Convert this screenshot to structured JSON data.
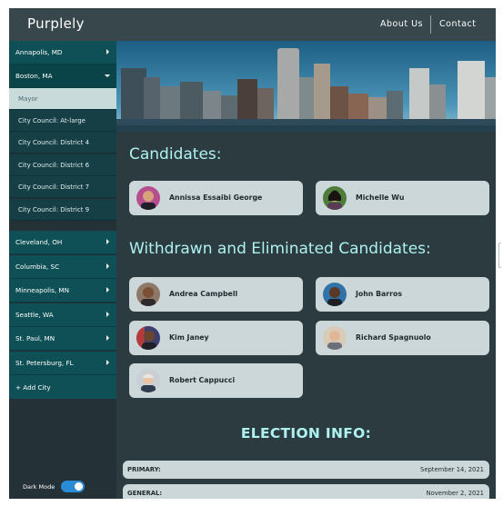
{
  "app": {
    "brand": "Purplely"
  },
  "nav": {
    "links": [
      "About Us",
      "Contact"
    ]
  },
  "sidebar": {
    "cities": [
      "Annapolis, MD",
      "Boston, MA",
      "Cleveland, OH",
      "Columbia, SC",
      "Minneapolis, MN",
      "Seattle, WA",
      "St. Paul, MN",
      "St. Petersburg, FL"
    ],
    "open_city": "Boston, MA",
    "races": [
      "Mayor",
      "City Council: At-large",
      "City Council: District 4",
      "City Council: District 6",
      "City Council: District 7",
      "City Council: District 9"
    ],
    "active_race": "Mayor",
    "add_city": "+ Add City",
    "dark_mode_label": "Dark Mode",
    "dark_mode_on": true
  },
  "main": {
    "candidates_title": "Candidates:",
    "candidates": [
      {
        "name": "Annissa Essaibi George"
      },
      {
        "name": "Michelle Wu"
      }
    ],
    "withdrawn_title": "Withdrawn and Eliminated Candidates:",
    "withdrawn": [
      {
        "name": "Andrea Campbell"
      },
      {
        "name": "John Barros"
      },
      {
        "name": "Kim Janey"
      },
      {
        "name": "Richard Spagnuolo"
      },
      {
        "name": "Robert Cappucci"
      }
    ],
    "election_info_title": "ELECTION INFO:",
    "election_info": [
      {
        "label": "PRIMARY:",
        "value": "September 14, 2021"
      },
      {
        "label": "GENERAL:",
        "value": "November 2, 2021"
      }
    ]
  },
  "colors": {
    "accent_cyan": "#aef2f0",
    "sidebar_teal": "#0e5055",
    "card_bg": "#ccd7da",
    "toggle_blue": "#2b8cd6"
  }
}
